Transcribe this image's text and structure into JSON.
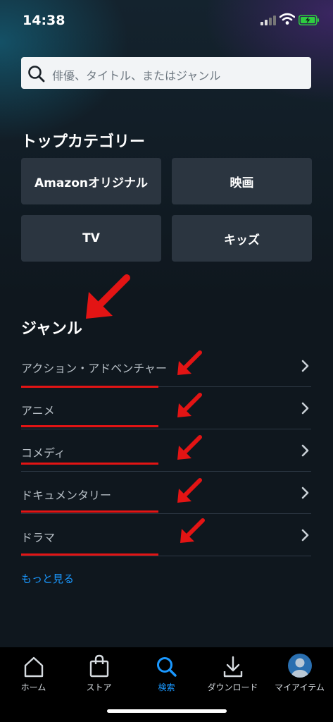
{
  "status": {
    "time": "14:38"
  },
  "search": {
    "placeholder": "俳優、タイトル、またはジャンル"
  },
  "top_categories": {
    "title": "トップカテゴリー",
    "tiles": [
      "Amazonオリジナル",
      "映画",
      "TV",
      "キッズ"
    ]
  },
  "genres": {
    "title": "ジャンル",
    "items": [
      "アクション・アドベンチャー",
      "アニメ",
      "コメディ",
      "ドキュメンタリー",
      "ドラマ"
    ],
    "more": "もっと見る"
  },
  "tabbar": {
    "items": [
      "ホーム",
      "ストア",
      "検索",
      "ダウンロード",
      "マイアイテム"
    ],
    "active": "検索"
  },
  "colors": {
    "accent": "#1a98ff",
    "annotation": "#e31414",
    "tile": "#2b3540",
    "background": "#0f171e"
  }
}
